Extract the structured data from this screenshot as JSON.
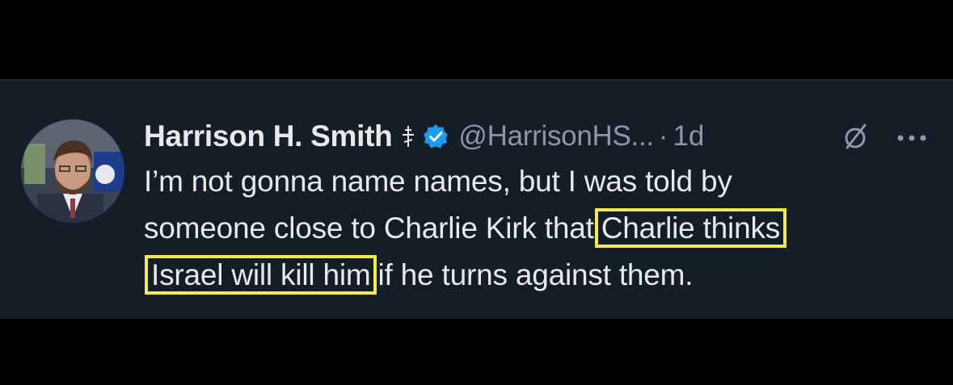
{
  "tweet": {
    "display_name": "Harrison H. Smith",
    "handle": "@HarrisonHS...",
    "separator": "·",
    "timestamp": "1d",
    "body": {
      "line1": "I’m not gonna name names, but I was told by",
      "line2_plain": "someone close to Charlie Kirk that",
      "line2_highlight": "Charlie thinks",
      "line3_highlight": "Israel will kill him",
      "line3_plain": "if he turns against them."
    }
  },
  "icons": {
    "cross": "orthodox-cross-icon",
    "verified": "verified-badge-icon",
    "grok": "grok-icon",
    "more": "more-options-icon"
  },
  "colors": {
    "background": "#000000",
    "tweet_background": "#151d27",
    "text_primary": "#e7e9ea",
    "text_secondary": "#8b98a5",
    "verified_blue": "#1d9bf0",
    "highlight_box": "#f2e94e"
  }
}
